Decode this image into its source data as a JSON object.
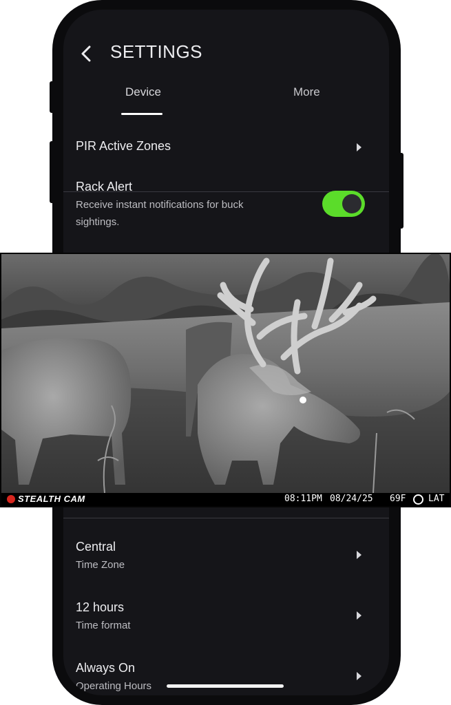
{
  "header": {
    "title": "SETTINGS"
  },
  "tabs": [
    {
      "label": "Device",
      "active": true
    },
    {
      "label": "More",
      "active": false
    }
  ],
  "settings_top": [
    {
      "title": "PIR Active Zones"
    },
    {
      "title": "Rack Alert",
      "subtitle_line1": "Receive instant notifications for buck",
      "subtitle_line2": "sightings.",
      "toggle_on": true
    }
  ],
  "settings_bottom": [
    {
      "title": "Central",
      "subtitle": "Time Zone"
    },
    {
      "title": "12 hours",
      "subtitle": "Time format"
    },
    {
      "title": "Always On",
      "subtitle": "Operating Hours"
    }
  ],
  "photo": {
    "brand": "STEALTH CAM",
    "time": "08:11PM",
    "date": "08/24/25",
    "temp": "69F",
    "moon_icon": "moon-phase-icon",
    "location": "LAT"
  },
  "colors": {
    "toggle_on": "#5bdc2a",
    "screen_bg": "#151519",
    "brand_red": "#d7261e"
  }
}
